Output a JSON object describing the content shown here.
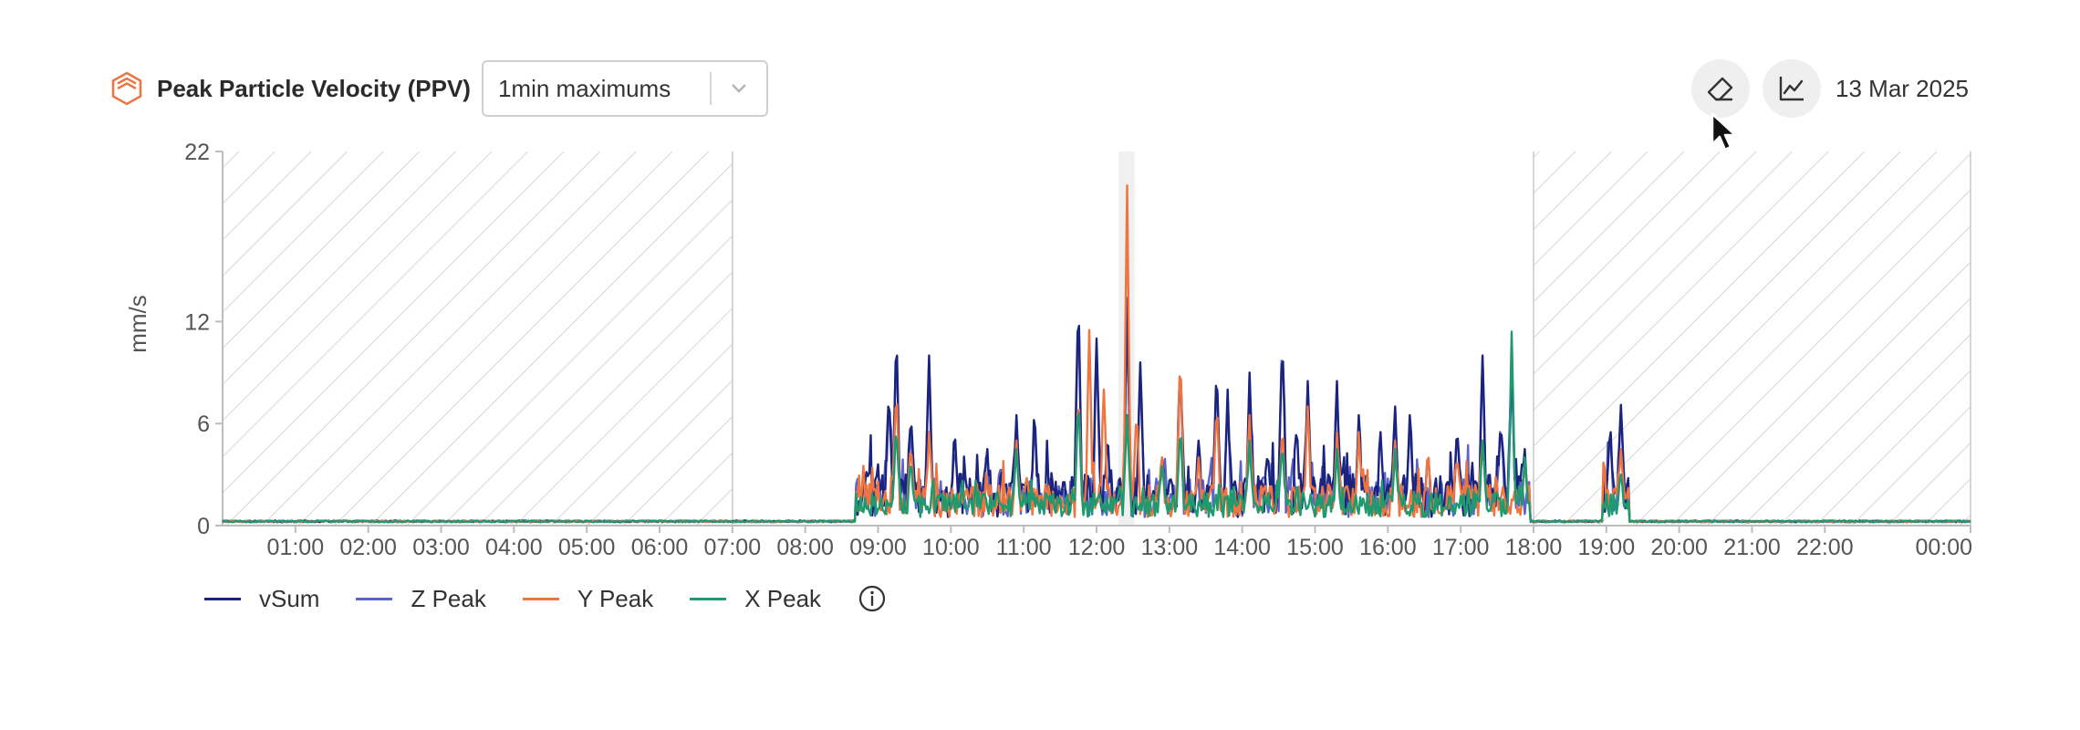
{
  "header": {
    "logo_icon": "hexagon-layers-icon",
    "title": "Peak Particle Velocity (PPV)",
    "aggregation_select": {
      "value": "1min maximums"
    }
  },
  "toolbar": {
    "eraser_icon": "eraser-icon",
    "chart_icon": "line-chart-icon",
    "date": "13 Mar 2025"
  },
  "colors": {
    "vSum": "#1a237e",
    "Z Peak": "#5c63c9",
    "Y Peak": "#ee7440",
    "X Peak": "#1f9a6e",
    "hatch": "#c8c8c8",
    "axis": "#bdbdbd",
    "logo": "#ee7440"
  },
  "chart_data": {
    "type": "line",
    "ylabel": "mm/s",
    "ylim": [
      0,
      22
    ],
    "yticks": [
      "0",
      "6",
      "12",
      "22"
    ],
    "xlim": [
      0,
      24
    ],
    "xticks": [
      "01:00",
      "02:00",
      "03:00",
      "04:00",
      "05:00",
      "06:00",
      "07:00",
      "08:00",
      "09:00",
      "10:00",
      "11:00",
      "12:00",
      "13:00",
      "14:00",
      "15:00",
      "16:00",
      "17:00",
      "18:00",
      "19:00",
      "20:00",
      "21:00",
      "22:00",
      "00:00"
    ],
    "xtick_hours": [
      1,
      2,
      3,
      4,
      5,
      6,
      7,
      8,
      9,
      10,
      11,
      12,
      13,
      14,
      15,
      16,
      17,
      18,
      19,
      20,
      21,
      22,
      24
    ],
    "hatched_ranges_hours": [
      [
        0,
        7
      ],
      [
        18,
        24
      ]
    ],
    "highlight_range_hours": [
      12.3,
      12.52
    ],
    "series_order": [
      "Z Peak",
      "vSum",
      "Y Peak",
      "X Peak"
    ],
    "legend": [
      "vSum",
      "Z Peak",
      "Y Peak",
      "X Peak"
    ],
    "peaks": {
      "vSum": [
        [
          8.85,
          3.5
        ],
        [
          9.15,
          8.0
        ],
        [
          9.25,
          11.4
        ],
        [
          9.45,
          6.5
        ],
        [
          9.7,
          10.0
        ],
        [
          10.05,
          5.5
        ],
        [
          10.5,
          4.5
        ],
        [
          10.9,
          6.5
        ],
        [
          11.15,
          6.5
        ],
        [
          11.75,
          14.0
        ],
        [
          12.0,
          11.0
        ],
        [
          12.15,
          5.5
        ],
        [
          12.42,
          13.4
        ],
        [
          12.6,
          9.6
        ],
        [
          12.9,
          4.0
        ],
        [
          13.15,
          10.0
        ],
        [
          13.4,
          5.0
        ],
        [
          13.65,
          9.5
        ],
        [
          13.8,
          8.0
        ],
        [
          14.1,
          9.0
        ],
        [
          14.35,
          4.5
        ],
        [
          14.55,
          11.4
        ],
        [
          14.75,
          6.0
        ],
        [
          14.9,
          8.5
        ],
        [
          15.3,
          8.5
        ],
        [
          15.6,
          6.5
        ],
        [
          15.9,
          5.5
        ],
        [
          16.1,
          7.0
        ],
        [
          16.3,
          6.5
        ],
        [
          16.55,
          4.5
        ],
        [
          16.95,
          6.0
        ],
        [
          17.3,
          10.0
        ],
        [
          17.55,
          6.5
        ],
        [
          17.7,
          9.5
        ],
        [
          17.88,
          4.5
        ],
        [
          19.05,
          6.0
        ],
        [
          19.2,
          7.1
        ]
      ],
      "Z Peak": [
        [
          9.15,
          7.5
        ],
        [
          9.25,
          11.2
        ],
        [
          9.45,
          6.0
        ],
        [
          9.7,
          9.8
        ],
        [
          10.05,
          5.0
        ],
        [
          10.5,
          4.2
        ],
        [
          10.9,
          6.0
        ],
        [
          11.15,
          6.3
        ],
        [
          11.75,
          13.4
        ],
        [
          12.0,
          10.5
        ],
        [
          12.42,
          13.0
        ],
        [
          12.6,
          9.4
        ],
        [
          12.9,
          3.8
        ],
        [
          13.15,
          9.8
        ],
        [
          13.65,
          9.3
        ],
        [
          13.8,
          7.6
        ],
        [
          14.1,
          8.8
        ],
        [
          14.55,
          11.4
        ],
        [
          14.9,
          8.2
        ],
        [
          15.3,
          8.3
        ],
        [
          15.6,
          6.2
        ],
        [
          16.1,
          6.8
        ],
        [
          16.3,
          6.3
        ],
        [
          16.95,
          5.8
        ],
        [
          17.3,
          9.8
        ],
        [
          17.55,
          6.2
        ],
        [
          17.7,
          9.3
        ],
        [
          19.05,
          5.5
        ],
        [
          19.2,
          6.8
        ]
      ],
      "Y Peak": [
        [
          9.25,
          8.5
        ],
        [
          9.45,
          5.0
        ],
        [
          9.7,
          5.5
        ],
        [
          10.9,
          5.0
        ],
        [
          11.75,
          8.0
        ],
        [
          11.9,
          11.5
        ],
        [
          12.1,
          8.0
        ],
        [
          12.42,
          20.0
        ],
        [
          12.55,
          7.0
        ],
        [
          12.9,
          4.0
        ],
        [
          13.15,
          10.2
        ],
        [
          13.4,
          4.0
        ],
        [
          13.65,
          7.5
        ],
        [
          14.1,
          6.5
        ],
        [
          14.55,
          6.0
        ],
        [
          14.9,
          7.0
        ],
        [
          15.3,
          5.5
        ],
        [
          15.6,
          5.5
        ],
        [
          16.1,
          5.0
        ],
        [
          16.55,
          4.5
        ],
        [
          16.95,
          4.0
        ],
        [
          17.3,
          5.0
        ],
        [
          17.88,
          3.5
        ],
        [
          19.2,
          4.5
        ]
      ],
      "X Peak": [
        [
          9.25,
          6.0
        ],
        [
          9.45,
          4.0
        ],
        [
          10.9,
          4.5
        ],
        [
          11.75,
          7.5
        ],
        [
          12.42,
          6.5
        ],
        [
          12.9,
          3.5
        ],
        [
          13.15,
          6.0
        ],
        [
          14.1,
          5.0
        ],
        [
          14.55,
          5.0
        ],
        [
          15.3,
          4.5
        ],
        [
          16.1,
          4.5
        ],
        [
          17.3,
          5.0
        ],
        [
          17.7,
          11.4
        ],
        [
          17.88,
          4.0
        ],
        [
          19.2,
          3.0
        ]
      ]
    },
    "baseline": 0.2,
    "activity_hours": [
      [
        8.7,
        17.95
      ],
      [
        18.95,
        19.3
      ]
    ]
  },
  "legend_info_icon": "info-icon"
}
